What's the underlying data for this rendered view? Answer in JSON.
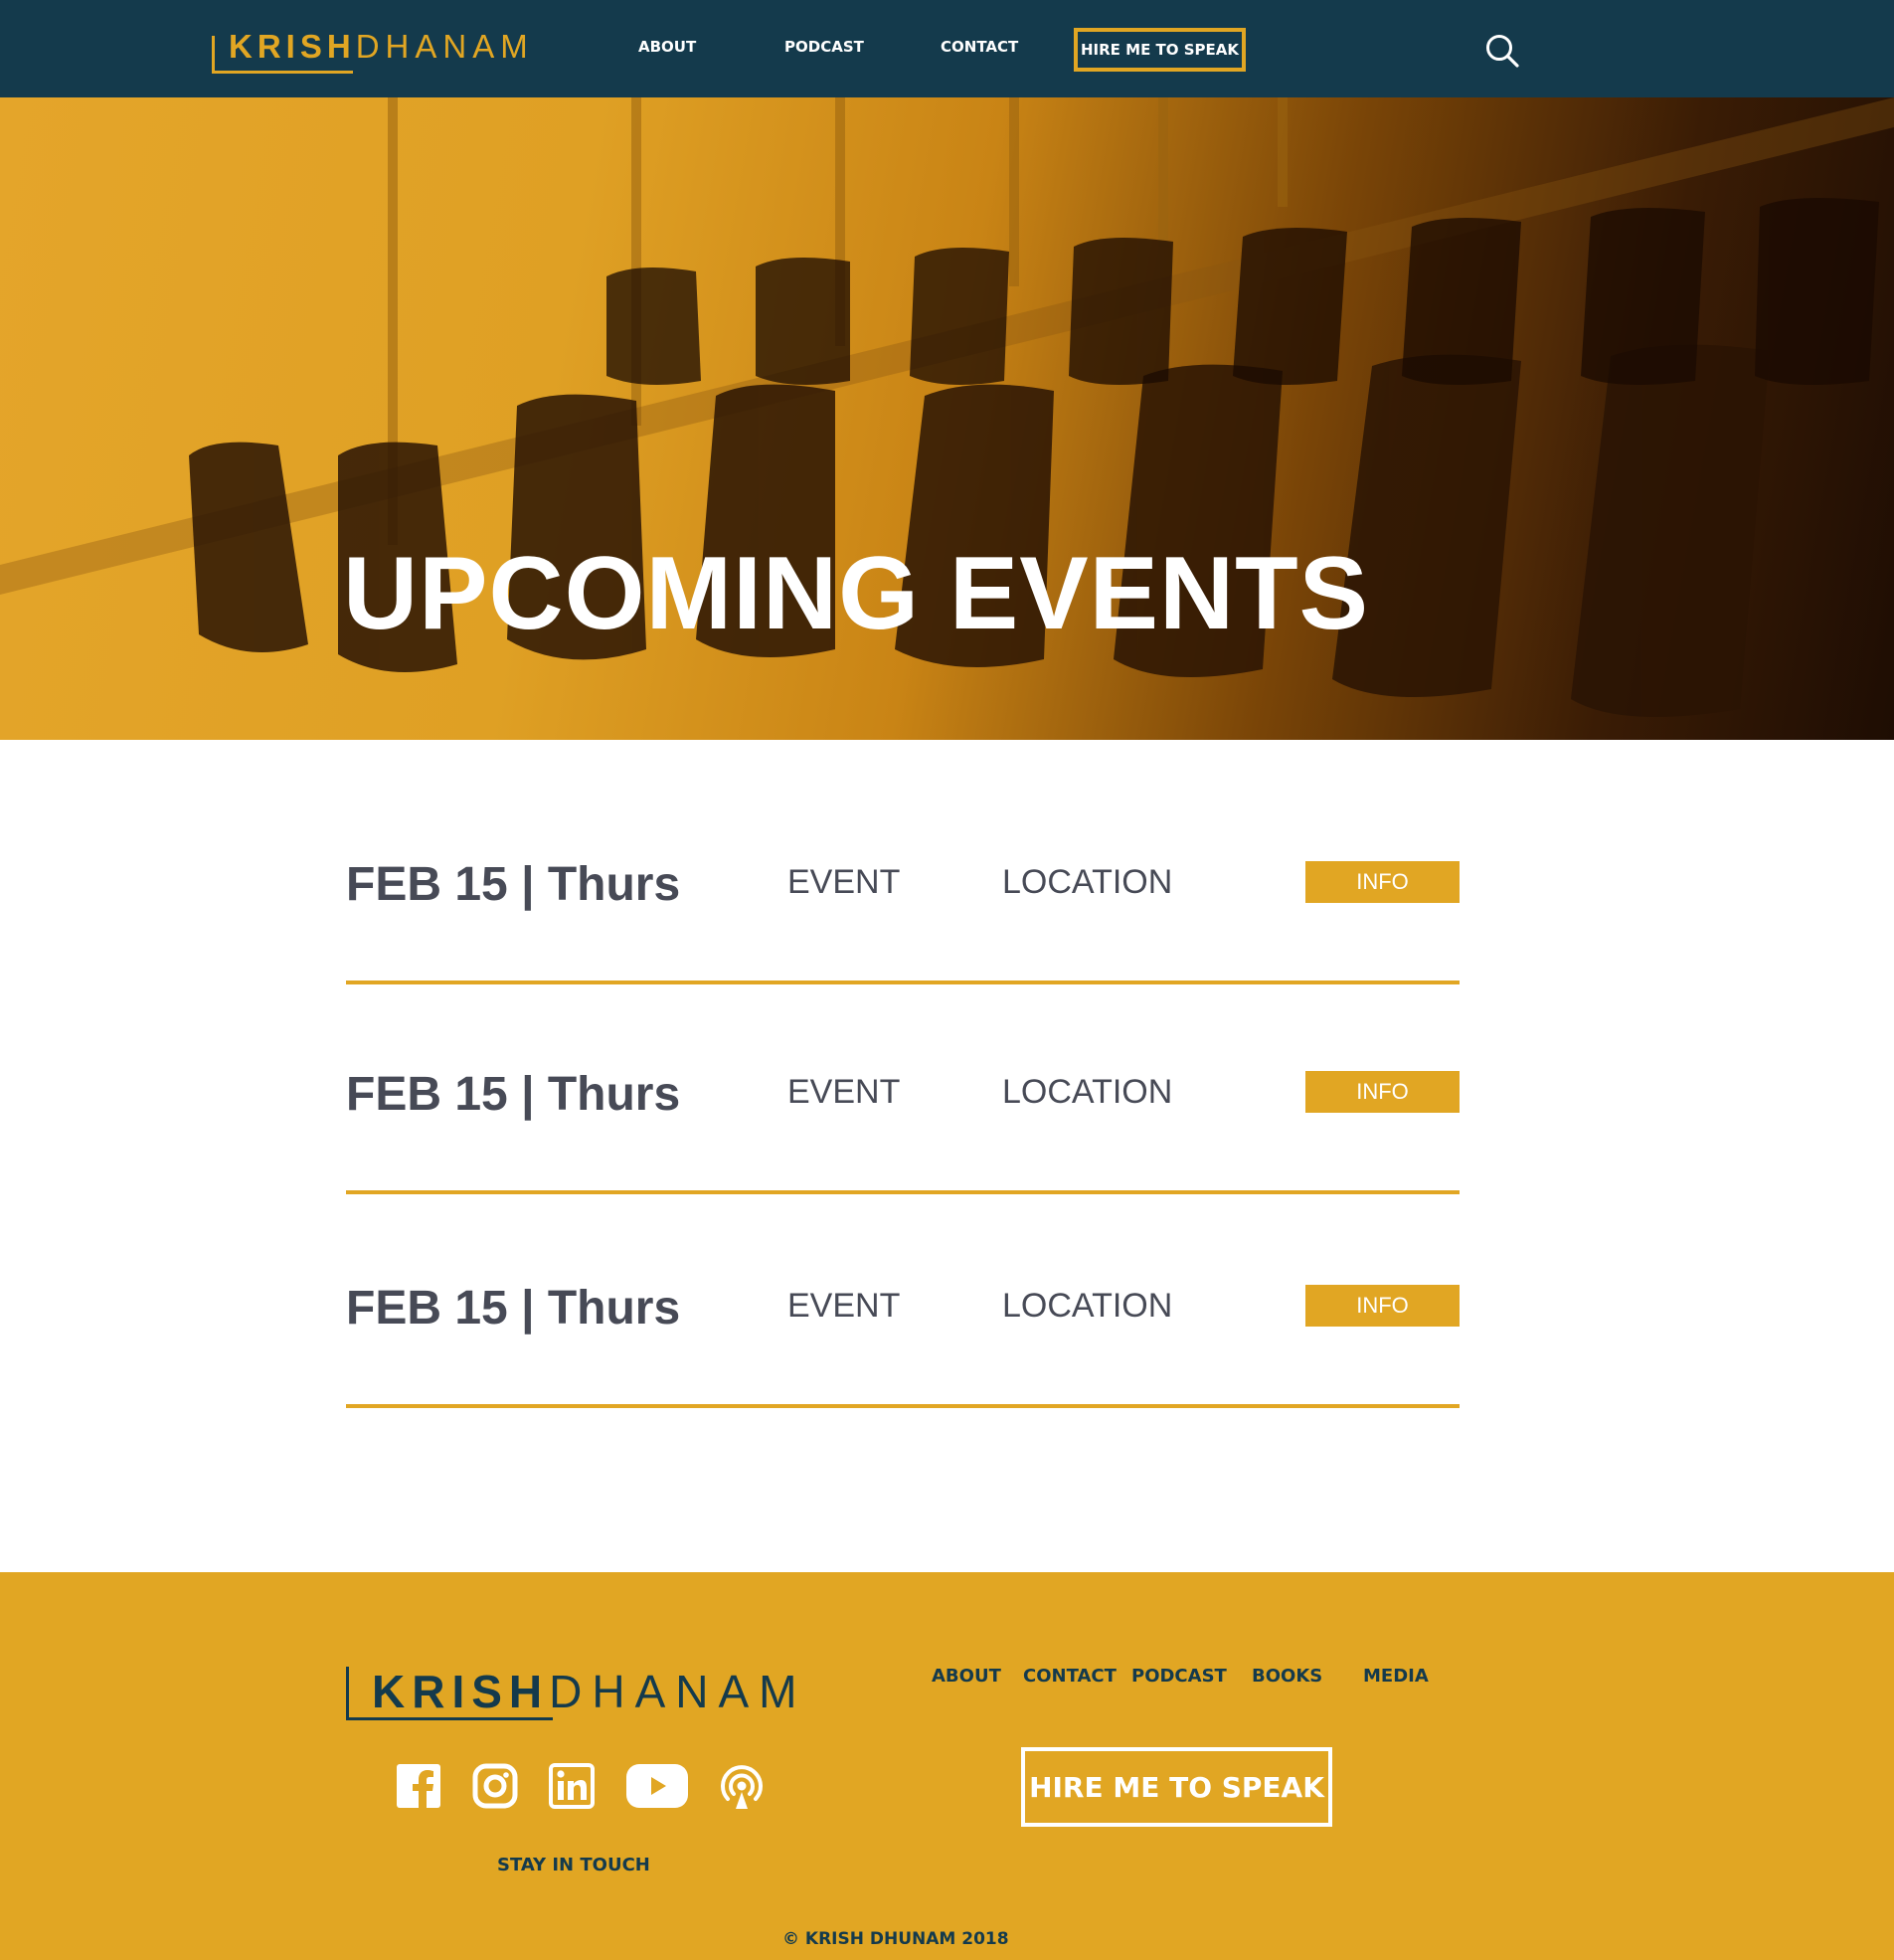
{
  "brand": {
    "first": "KRISH",
    "last": "DHANAM"
  },
  "nav": {
    "about": "ABOUT",
    "podcast": "PODCAST",
    "contact": "CONTACT",
    "hire": "HIRE ME TO SPEAK"
  },
  "hero": {
    "title": "UPCOMING EVENTS"
  },
  "events": [
    {
      "date": "FEB 15 | Thurs",
      "event": "EVENT",
      "location": "LOCATION",
      "info": "INFO"
    },
    {
      "date": "FEB 15 | Thurs",
      "event": "EVENT",
      "location": "LOCATION",
      "info": "INFO"
    },
    {
      "date": "FEB 15 | Thurs",
      "event": "EVENT",
      "location": "LOCATION",
      "info": "INFO"
    }
  ],
  "footer": {
    "links": {
      "about": "ABOUT",
      "contact": "CONTACT",
      "podcast": "PODCAST",
      "books": "BOOKS",
      "media": "MEDIA"
    },
    "hire": "HIRE ME TO SPEAK",
    "social": [
      "facebook-icon",
      "instagram-icon",
      "linkedin-icon",
      "youtube-icon",
      "podcast-icon"
    ],
    "stay": "STAY IN TOUCH",
    "copyright": "© KRISH DHUNAM 2018"
  },
  "colors": {
    "navy": "#143a4c",
    "gold": "#e1a623",
    "text": "#474a56"
  }
}
